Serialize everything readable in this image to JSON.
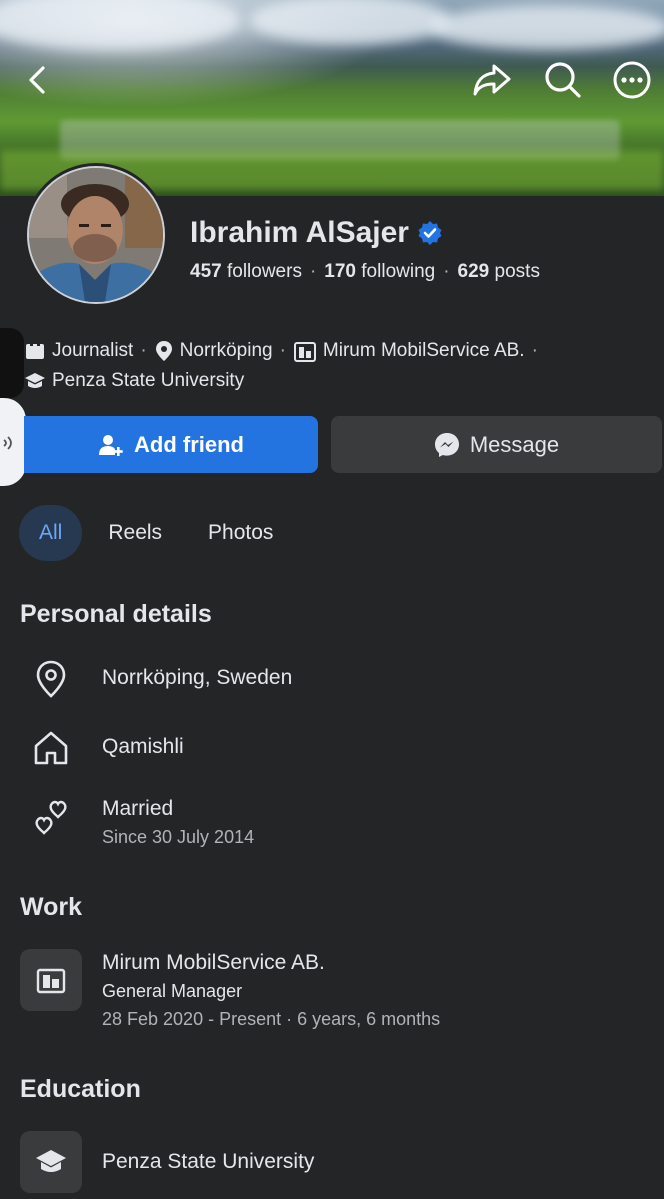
{
  "profile": {
    "name": "Ibrahim AlSajer",
    "followers_count": "457",
    "followers_label": "followers",
    "following_count": "170",
    "following_label": "following",
    "posts_count": "629",
    "posts_label": "posts",
    "verified": true
  },
  "intro": {
    "job": "Journalist",
    "city": "Norrköping",
    "company": "Mirum MobilService AB.",
    "school": "Penza State University"
  },
  "actions": {
    "add_friend": "Add friend",
    "message": "Message"
  },
  "tabs": [
    {
      "label": "All",
      "active": true
    },
    {
      "label": "Reels",
      "active": false
    },
    {
      "label": "Photos",
      "active": false
    }
  ],
  "personal": {
    "title": "Personal details",
    "location": "Norrköping, Sweden",
    "hometown": "Qamishli",
    "relationship": "Married",
    "relationship_since": "Since 30 July 2014"
  },
  "work": {
    "title": "Work",
    "company": "Mirum MobilService AB.",
    "position": "General  Manager",
    "period": "28 Feb 2020 - Present · 6 years, 6 months"
  },
  "education": {
    "title": "Education",
    "school": "Penza State University"
  },
  "colors": {
    "background": "#242526",
    "primary": "#2374e1",
    "secondary_button": "#3a3b3c",
    "active_tab_bg": "#263951",
    "active_tab_text": "#6ba7f5"
  }
}
